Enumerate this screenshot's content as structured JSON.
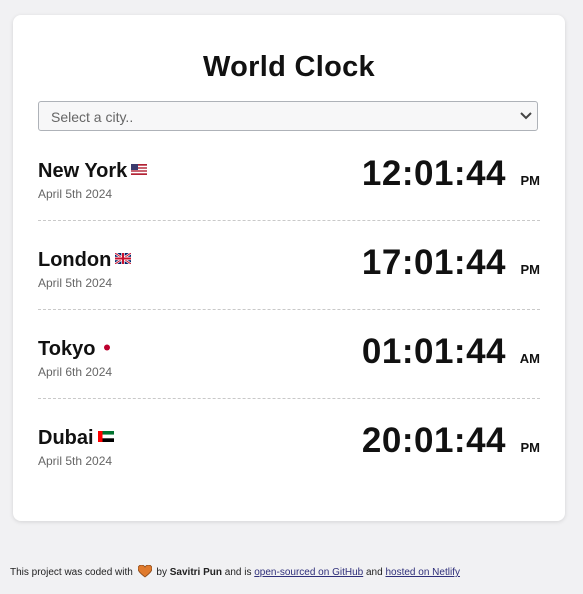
{
  "title": "World Clock",
  "select": {
    "placeholder": "Select a city.."
  },
  "cities": [
    {
      "name": "New York",
      "flag": "us-flag-icon",
      "date": "April 5th 2024",
      "time": "12:01:44",
      "ampm": "PM"
    },
    {
      "name": "London",
      "flag": "uk-flag-icon",
      "date": "April 5th 2024",
      "time": "17:01:44",
      "ampm": "PM"
    },
    {
      "name": "Tokyo",
      "flag": "japan-flag-icon",
      "date": "April 6th 2024",
      "time": "01:01:44",
      "ampm": "AM"
    },
    {
      "name": "Dubai",
      "flag": "uae-flag-icon",
      "date": "April 5th 2024",
      "time": "20:01:44",
      "ampm": "PM"
    }
  ],
  "footer": {
    "prefix": "This project was coded with",
    "by": "by",
    "author": "Savitri Pun",
    "and_is": "and is",
    "github_link": "open-sourced on GitHub",
    "and": "and",
    "netlify_link": "hosted on Netlify"
  },
  "colors": {
    "background": "#f1f1f3",
    "card": "#ffffff",
    "text": "#111111",
    "muted": "#666666",
    "link": "#2f2f7a",
    "heart": "#e07a2c"
  }
}
